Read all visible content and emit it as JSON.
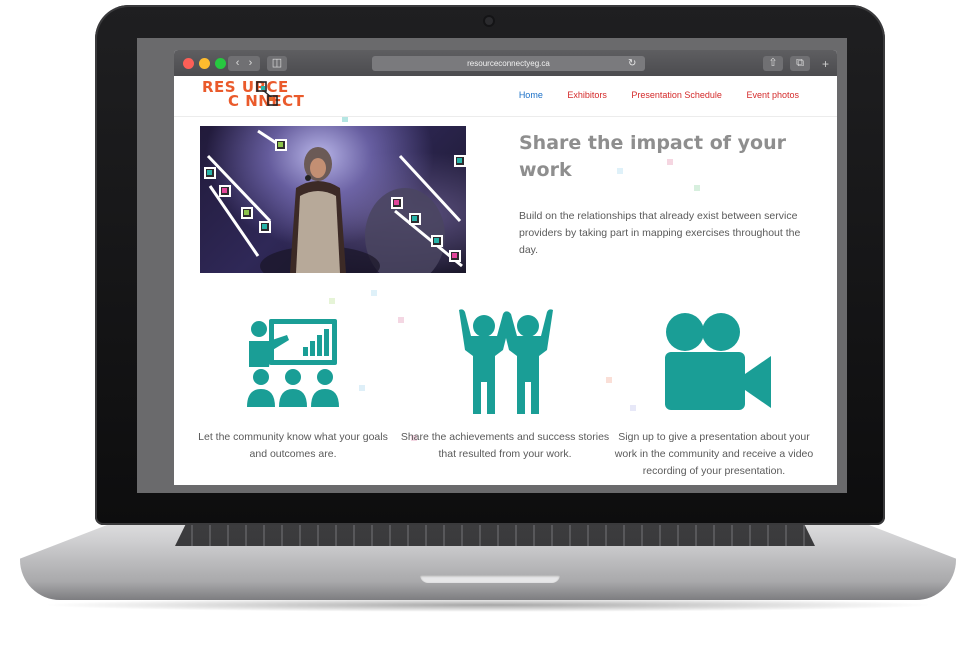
{
  "browser": {
    "url": "resourceconnectyeg.ca"
  },
  "site": {
    "logo_line1": "RES URCE",
    "logo_line2": "C NNECT",
    "nav": [
      {
        "label": "Home"
      },
      {
        "label": "Exhibitors"
      },
      {
        "label": "Presentation Schedule"
      },
      {
        "label": "Event photos"
      }
    ]
  },
  "hero": {
    "title": "Share the impact of your work",
    "text": "Build on the relationships that already exist between service providers by taking part in mapping exercises throughout the day."
  },
  "features": [
    {
      "icon": "presentation-audience-icon",
      "text": "Let the community know what your goals and outcomes are."
    },
    {
      "icon": "celebrating-people-icon",
      "text": "Share the achievements and success stories that resulted from your work."
    },
    {
      "icon": "video-camera-icon",
      "text": "Sign up to give a presentation about your work in the community and receive a video recording of your presentation."
    }
  ],
  "colors": {
    "brand_orange": "#ea5a2b",
    "nav_red": "#d42a2a",
    "nav_active_blue": "#1b70c7",
    "icon_teal": "#1a9e96"
  }
}
